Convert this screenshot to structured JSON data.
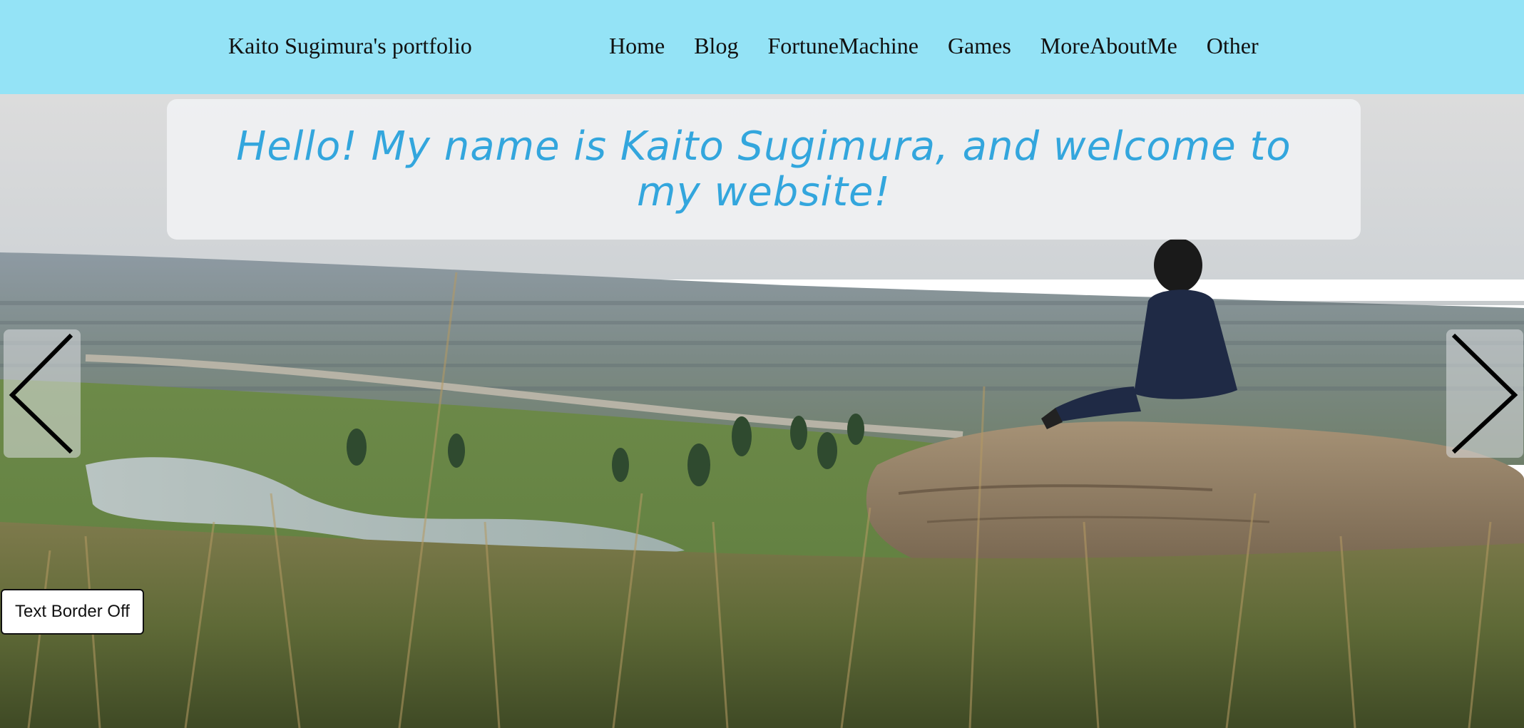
{
  "header": {
    "brand": "Kaito Sugimura's portfolio",
    "nav": [
      {
        "label": "Home"
      },
      {
        "label": "Blog"
      },
      {
        "label": "FortuneMachine"
      },
      {
        "label": "Games"
      },
      {
        "label": "MoreAboutMe"
      },
      {
        "label": "Other"
      }
    ],
    "background_color": "#94e3f6"
  },
  "hero": {
    "welcome_text": "Hello! My name is Kaito Sugimura, and welcome to my website!",
    "welcome_color": "#33a6dd",
    "prev_icon": "chevron-left-icon",
    "next_icon": "chevron-right-icon"
  },
  "controls": {
    "text_border_toggle": "Text Border Off"
  }
}
